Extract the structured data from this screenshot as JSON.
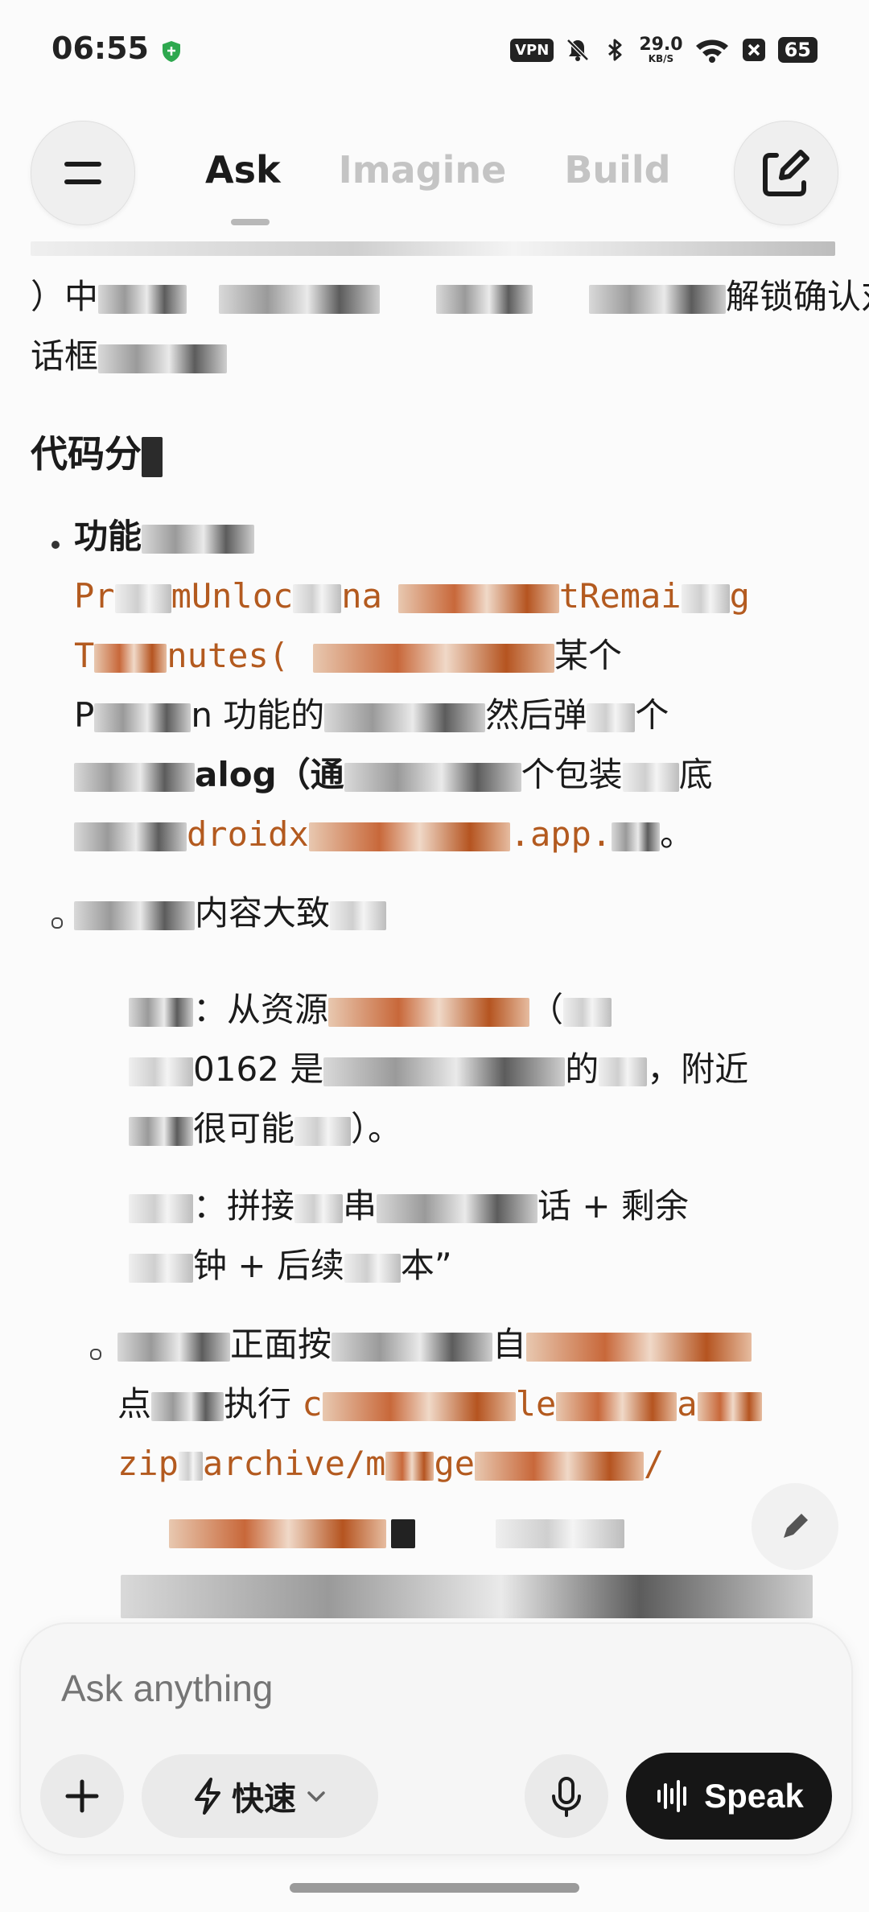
{
  "status_bar": {
    "time": "06:55",
    "vpn_label": "VPN",
    "net_speed_value": "29.0",
    "net_speed_unit": "KB/S",
    "battery_level": "65"
  },
  "nav": {
    "tabs": [
      {
        "label": "Ask",
        "active": true
      },
      {
        "label": "Imagine",
        "active": false
      },
      {
        "label": "Build",
        "active": false
      }
    ]
  },
  "content": {
    "line1_prefix": "）中",
    "line1_mid": "解锁确认对",
    "line2_start": "话框",
    "heading": "代码分",
    "b1_label": "功能",
    "b1_code1_start": "Pr",
    "b1_code1_mid": "mUnloc",
    "b1_code1_mid2": "na",
    "b1_code1_end": "tRemai",
    "b1_code1_end2": "g",
    "b1_code2_start": "T",
    "b1_code2_mid": "nutes(",
    "b1_code2_end_text": "某个",
    "b1_line3_a": "P",
    "b1_line3_b": "n 功能的",
    "b1_line3_c": "然后弹",
    "b1_line3_d": "个",
    "b1_line4_a": "alog（通",
    "b1_line4_b": "个包装",
    "b1_line4_c": "底",
    "b1_code5_a": "droidx",
    "b1_code5_b": ".app.",
    "b1_line5_end": "。",
    "b2_label": "内容大致",
    "sub1_a": "：从资源",
    "sub1_b": "（",
    "sub1_line2_a": "0162 是",
    "sub1_line2_b": "的",
    "sub1_line2_c": "，附近",
    "sub1_line3_a": "很可能",
    "sub1_line3_b": "）。",
    "sub2_a": "：拼接",
    "sub2_b": "串",
    "sub2_c": "话 + 剩余",
    "sub2_line2_a": "钟 + 后续",
    "sub2_line2_b": "本”",
    "b3_line1_a": "正面按",
    "b3_line1_b": "自",
    "b3_line2_a": "点",
    "b3_line2_b": "执行",
    "b3_line2_code": "c",
    "b3_line2_code2": "le",
    "b3_line2_code3": "a",
    "b3_line3_code_a": "zip",
    "b3_line3_code_b": "archive/m",
    "b3_line3_code_c": "ge",
    "b3_line3_code_d": "/"
  },
  "composer": {
    "placeholder": "Ask anything",
    "mode_label": "快速",
    "speak_label": "Speak"
  }
}
